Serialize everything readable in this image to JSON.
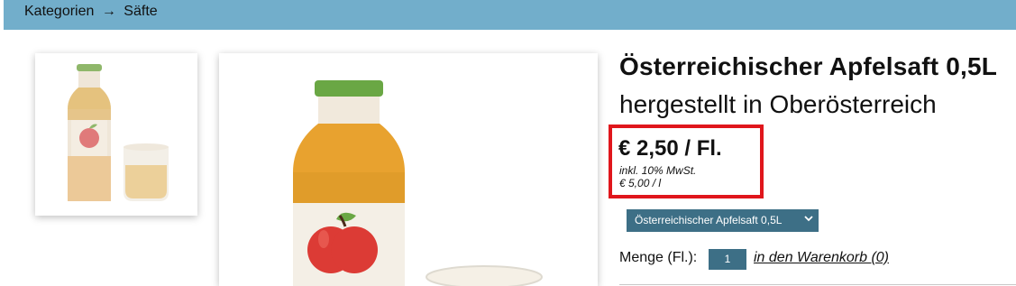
{
  "breadcrumb": {
    "parent": "Kategorien",
    "separator": "→",
    "current": "Säfte"
  },
  "product": {
    "title": "Österreichischer Apfelsaft 0,5L",
    "subtitle": "hergestellt in Oberösterreich",
    "price": "€ 2,50 / Fl.",
    "tax_note": "inkl. 10% MwSt.",
    "unit_price": "€ 5,00 / l",
    "variant_selected": "Österreichischer Apfelsaft 0,5L"
  },
  "cart": {
    "quantity_label": "Menge (Fl.):",
    "quantity_value": "1",
    "add_link": "in den Warenkorb (0)"
  },
  "colors": {
    "header": "#72aecb",
    "control": "#3d6f86",
    "highlight": "#e0161c"
  }
}
